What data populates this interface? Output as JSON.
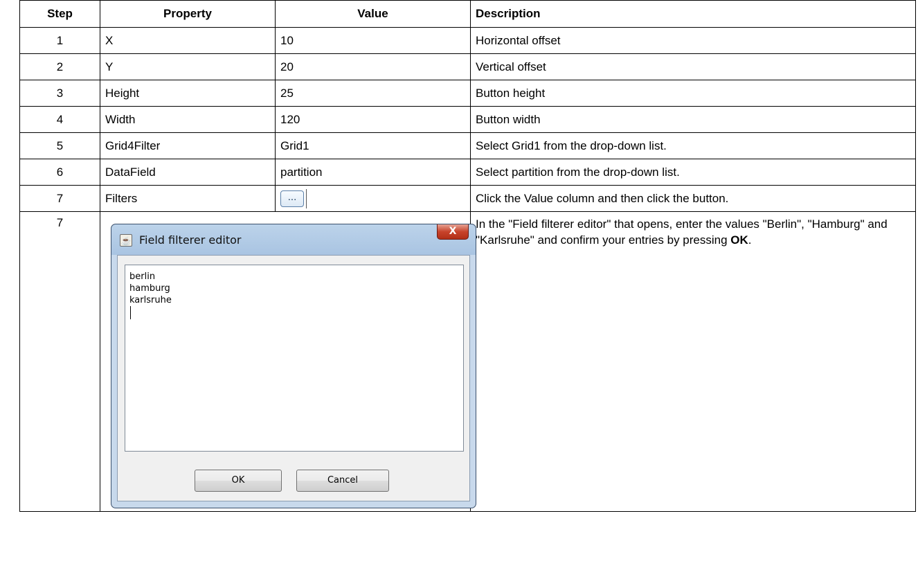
{
  "table": {
    "headers": {
      "step": "Step",
      "property": "Property",
      "value": "Value",
      "description": "Description"
    },
    "rows": [
      {
        "step": "1",
        "property": "X",
        "value": "10",
        "description": "Horizontal offset"
      },
      {
        "step": "2",
        "property": "Y",
        "value": "20",
        "description": "Vertical offset"
      },
      {
        "step": "3",
        "property": "Height",
        "value": "25",
        "description": "Button height"
      },
      {
        "step": "4",
        "property": "Width",
        "value": "120",
        "description": "Button width"
      },
      {
        "step": "5",
        "property": "Grid4Filter",
        "value": "Grid1",
        "description": "Select Grid1 from the drop-down list."
      },
      {
        "step": "6",
        "property": "DataField",
        "value": "partition",
        "description": "Select partition from the drop-down list."
      },
      {
        "step": "7",
        "property": "Filters",
        "value_button": "...",
        "description": "Click the Value column and then click the button."
      }
    ],
    "last_row": {
      "step": "7",
      "description_prefix": "In the \"Field filterer editor\" that opens, enter the values \"Berlin\", \"Hamburg\" and \"Karlsruhe\" and confirm your entries by pressing ",
      "description_bold": "OK",
      "description_suffix": "."
    }
  },
  "dialog": {
    "title": "Field filterer editor",
    "close_label": "X",
    "text_lines": [
      "berlin",
      "hamburg",
      "karlsruhe"
    ],
    "ok_label": "OK",
    "cancel_label": "Cancel",
    "icon": "java-coffee-icon"
  }
}
